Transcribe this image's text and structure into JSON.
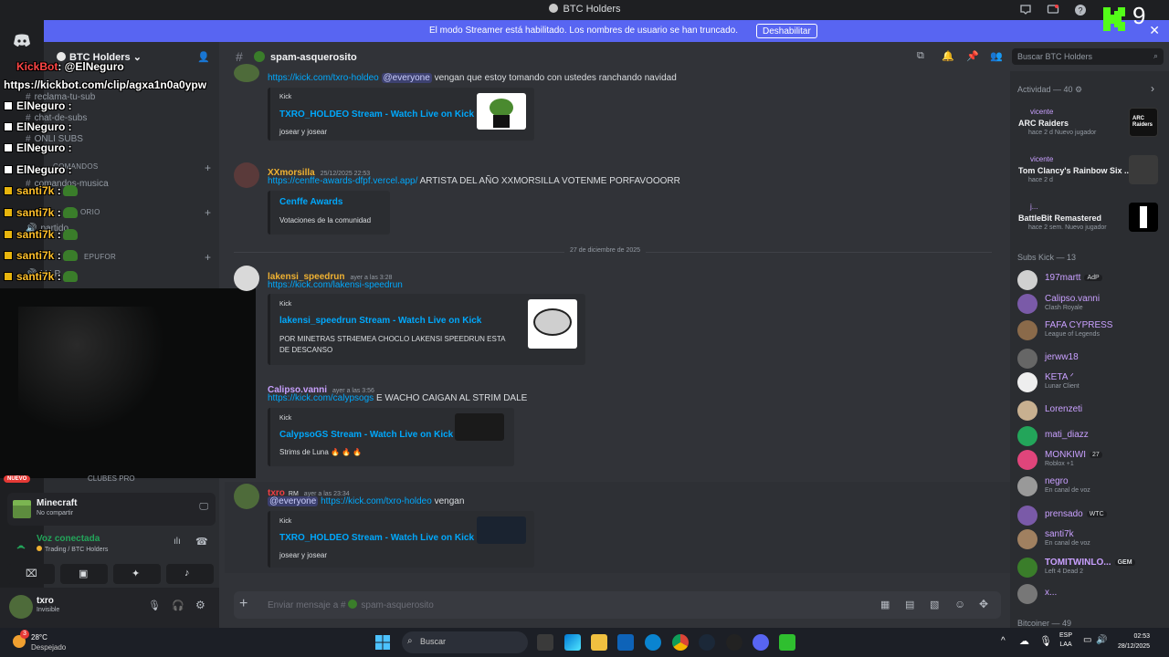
{
  "window": {
    "title": "BTC Holders"
  },
  "banner": {
    "text": "El modo Streamer está habilitado. Los nombres de usuario se han truncado.",
    "button": "Deshabilitar",
    "kick_num": "9"
  },
  "server": {
    "name": "BTC Holders"
  },
  "channels": [
    {
      "name": "reclama-tu-sub"
    },
    {
      "name": "chat-de-subs"
    },
    {
      "name": "ONLI SUBS"
    },
    {
      "name": "comandos-musica"
    },
    {
      "name": "partido"
    },
    {
      "name": "V I P"
    }
  ],
  "categories": [
    {
      "name": "COMANDOS"
    },
    {
      "name": "ORIO"
    },
    {
      "name": "EPUFOR"
    }
  ],
  "overlay": [
    {
      "user": "KickBot",
      "text": ": @ElNeguro"
    },
    {
      "user": "",
      "text": "https://kickbot.com/clip/agxa1n0a0ypw"
    },
    {
      "user": "ElNeguro",
      "text": " :"
    },
    {
      "user": "ElNeguro",
      "text": " :"
    },
    {
      "user": "ElNeguro",
      "text": " :"
    },
    {
      "user": "ElNeguro",
      "text": " :"
    },
    {
      "user": "santi7k",
      "text": " :"
    },
    {
      "user": "santi7k",
      "text": " :"
    },
    {
      "user": "santi7k",
      "text": " :"
    },
    {
      "user": "santi7k",
      "text": " :"
    },
    {
      "user": "santi7k",
      "text": " :"
    }
  ],
  "panel": {
    "activity_game": "Minecraft",
    "activity_sub": "No compartir",
    "voice_status": "Voz conectada",
    "voice_channel": "Trading / BTC Holders",
    "user_name": "txro",
    "user_status": "Invisible",
    "nuevo_badge": "NUEVO",
    "stage_label": "CLUBES PRO"
  },
  "chat": {
    "channel": "spam-asquerosito",
    "search_placeholder": "Buscar BTC Holders",
    "composer_placeholder": "Enviar mensaje a # ",
    "composer_channel": "spam-asquerosito",
    "date_divider": "27 de diciembre de 2025",
    "messages": [
      {
        "author": "",
        "time": "",
        "link": "https://kick.com/txro-holdeo",
        "mention": "@everyone",
        "text": "vengan que estoy tomando con ustedes ranchando navidad",
        "embed": {
          "provider": "Kick",
          "title": "TXRO_HOLDEO Stream - Watch Live on Kick",
          "desc": "josear y josear"
        }
      },
      {
        "author": "XXmorsilla",
        "time": "25/12/2025 22:53",
        "link": "https://cenffe-awards-dfpf.vercel.app/",
        "mention": "",
        "text": "ARTISTA DEL AÑO XXMORSILLA VOTENME PORFAVOOORR",
        "embed": {
          "provider": "",
          "title": "Cenffe Awards",
          "desc": "Votaciones de la comunidad"
        }
      },
      {
        "author": "lakensi_speedrun",
        "time": "ayer a las 3:28",
        "link": "https://kick.com/lakensi-speedrun",
        "mention": "",
        "text": "",
        "embed": {
          "provider": "Kick",
          "title": "lakensi_speedrun Stream - Watch Live on Kick",
          "desc": "POR MINETRAS STR4EMEA CHOCLO LAKENSI SPEEDRUN ESTA DE DESCANSO"
        }
      },
      {
        "author": "Calipso.vanni",
        "time": "ayer a las 3:56",
        "link": "https://kick.com/calypsogs",
        "mention": "",
        "text": "E WACHO CAIGAN AL STRIM DALE",
        "embed": {
          "provider": "Kick",
          "title": "CalypsoGS Stream - Watch Live on Kick",
          "desc": "Strims de Luna 🔥 🔥 🔥"
        }
      },
      {
        "author": "txro",
        "time": "ayer a las 23:34",
        "role": "RM",
        "link": "https://kick.com/txro-holdeo",
        "mention": "@everyone",
        "text": "vengan",
        "embed": {
          "provider": "Kick",
          "title": "TXRO_HOLDEO Stream - Watch Live on Kick",
          "desc": "josear y josear"
        }
      }
    ]
  },
  "members": {
    "activity_header": "Actividad — 40",
    "activities": [
      {
        "user": "vicente",
        "game": "ARC Raiders",
        "meta": "hace 2 d",
        "tag": "Nuevo jugador",
        "art_text": "ARC Raiders"
      },
      {
        "user": "vicente",
        "game": "Tom Clancy's Rainbow Six ...",
        "meta": "hace 2 d",
        "tag": "",
        "art_text": ""
      },
      {
        "user": "j...",
        "game": "BattleBit Remastered",
        "meta": "hace 2 sem.",
        "tag": "Nuevo jugador",
        "art_text": ""
      }
    ],
    "subs_header": "Subs Kick — 13",
    "subs": [
      {
        "name": "197martt",
        "status": "",
        "tag": "AdP"
      },
      {
        "name": "Calipso.vanni",
        "status": "Clash Royale",
        "tag": ""
      },
      {
        "name": "FAFA CYPRESS",
        "status": "League of Legends",
        "tag": ""
      },
      {
        "name": "jerww18",
        "status": "",
        "tag": ""
      },
      {
        "name": "KETA ᐟ",
        "status": "Lunar Client",
        "tag": ""
      },
      {
        "name": "Lorenzeti",
        "status": "",
        "tag": ""
      },
      {
        "name": "mati_diazz",
        "status": "",
        "tag": ""
      },
      {
        "name": "MONKIWI",
        "status": "Roblox +1",
        "tag": "27"
      },
      {
        "name": "negro",
        "status": "En canal de voz",
        "tag": ""
      },
      {
        "name": "prensado",
        "status": "",
        "tag": "WTC"
      },
      {
        "name": "santi7k",
        "status": "En canal de voz",
        "tag": ""
      },
      {
        "name": "TOMITWINLO...",
        "status": "Left 4 Dead 2",
        "tag": "GEM"
      },
      {
        "name": "x...",
        "status": "",
        "tag": ""
      }
    ],
    "bitcoiner_header": "Bitcoiner — 49"
  },
  "taskbar": {
    "weather_temp": "28°C",
    "weather_desc": "Despejado",
    "weather_badge": "3",
    "search": "Buscar",
    "lang": "ESP",
    "lang2": "LAA",
    "time": "02:53",
    "date": "28/12/2025"
  },
  "colors": {
    "blurple": "#5865f2",
    "bg_chat": "#313338",
    "bg_sidebar": "#2b2d31",
    "link": "#00a8fc",
    "kick_green": "#53fc18"
  }
}
